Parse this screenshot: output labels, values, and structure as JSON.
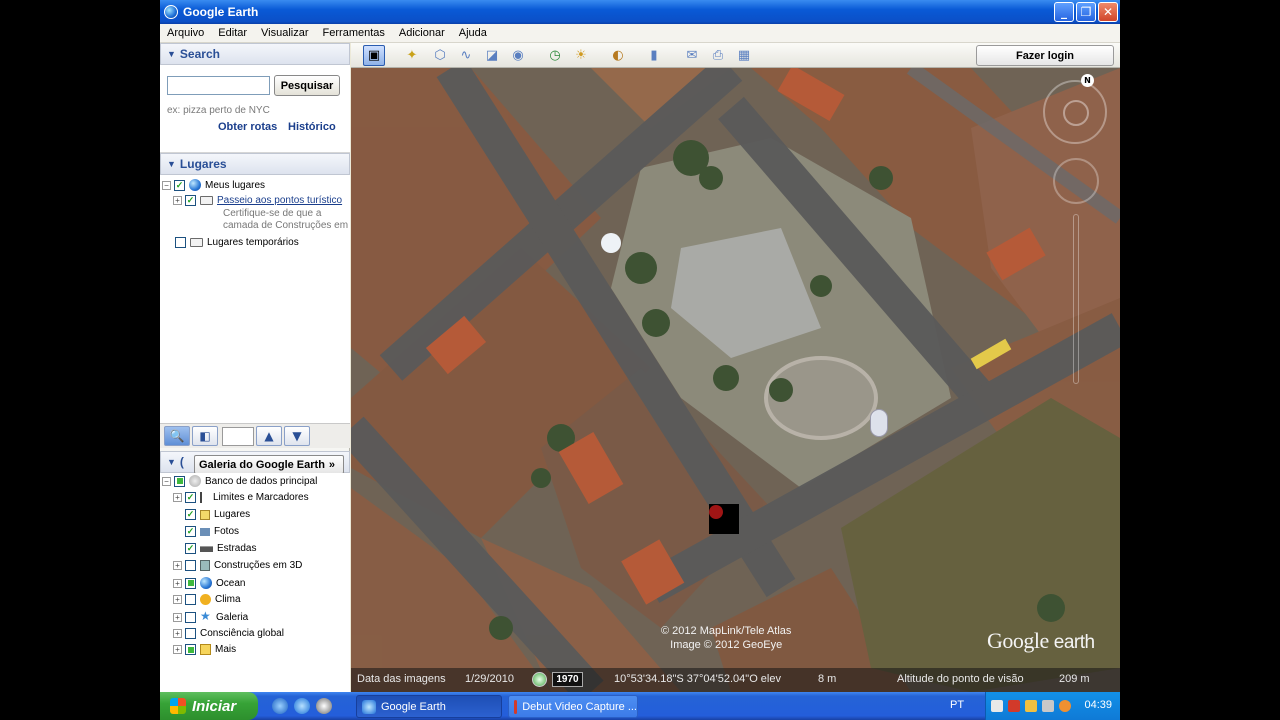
{
  "window": {
    "title": "Google Earth",
    "buttons": [
      "_",
      "❐",
      "✕"
    ]
  },
  "menu": [
    "Arquivo",
    "Editar",
    "Visualizar",
    "Ferramentas",
    "Adicionar",
    "Ajuda"
  ],
  "search": {
    "header": "Search",
    "button": "Pesquisar",
    "placeholder_hint": "ex: pizza perto de NYC",
    "links": [
      "Obter rotas",
      "Histórico"
    ]
  },
  "places": {
    "header": "Lugares",
    "items": [
      {
        "label": "Meus lugares"
      },
      {
        "label": "Passeio aos pontos turístico",
        "desc1": "Certifique-se de que a",
        "desc2": "camada de Construções em"
      },
      {
        "label": "Lugares temporários"
      }
    ]
  },
  "layers": {
    "galeria_label": "Galeria do Google Earth",
    "galeria_arrow": "»",
    "items": [
      {
        "label": "Banco de dados principal"
      },
      {
        "label": "Limites e Marcadores"
      },
      {
        "label": "Lugares"
      },
      {
        "label": "Fotos"
      },
      {
        "label": "Estradas"
      },
      {
        "label": "Construções em 3D"
      },
      {
        "label": "Ocean"
      },
      {
        "label": "Clima"
      },
      {
        "label": "Galeria"
      },
      {
        "label": "Consciência global"
      },
      {
        "label": "Mais"
      }
    ]
  },
  "toolbar": {
    "login_label": "Fazer login"
  },
  "map": {
    "compass_label": "N",
    "copyright_line1": "© 2012 MapLink/Tele Atlas",
    "copyright_line2": "Image © 2012 GeoEye",
    "logo_google": "Google",
    "logo_earth": "earth"
  },
  "status": {
    "date_label": "Data das imagens",
    "date_value": "1/29/2010",
    "year": "1970",
    "coords": "10°53'34.18\"S  37°04'52.04\"O  elev",
    "elev": "8 m",
    "altitude_label": "Altitude do ponto de visão",
    "altitude_value": "209 m"
  },
  "taskbar": {
    "start_label": "Iniciar",
    "tasks": [
      "Google Earth",
      "Debut Video Capture ..."
    ],
    "lang": "PT",
    "clock": "04:39"
  },
  "colors": {
    "titlebar": "#0a5ad6",
    "accent_link": "#1a3e8c",
    "taskbar": "#245edb",
    "start": "#37a337"
  }
}
